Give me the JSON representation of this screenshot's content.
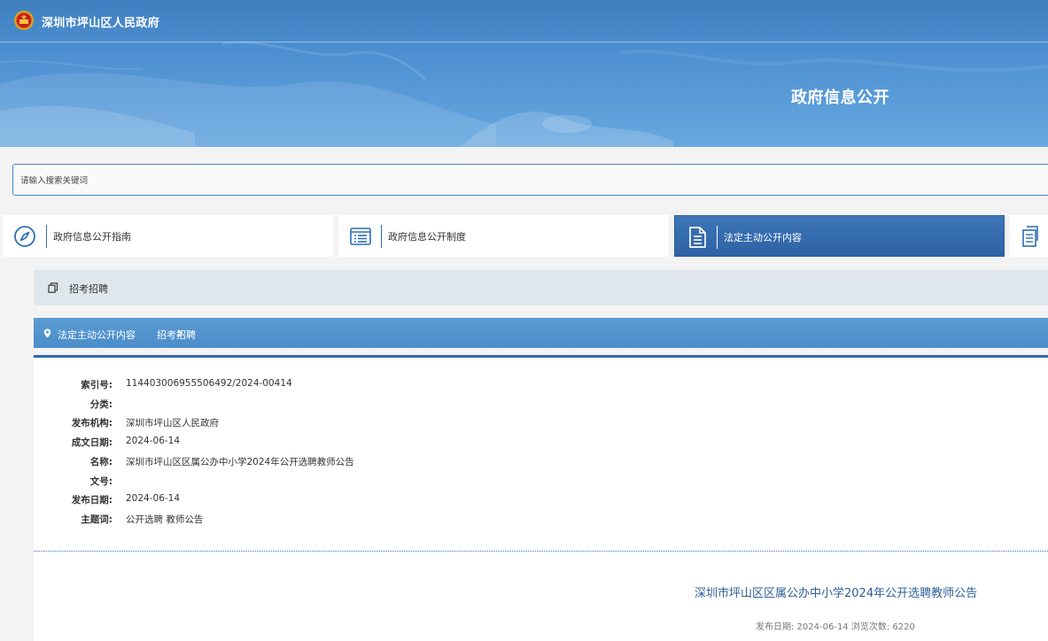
{
  "header": {
    "site_name": "深圳市坪山区人民政府",
    "banner_title": "政府信息公开"
  },
  "search": {
    "placeholder": "请输入搜索关键词",
    "value": ""
  },
  "nav": {
    "tabs": [
      {
        "label": "政府信息公开指南",
        "icon": "compass-icon",
        "active": false
      },
      {
        "label": "政府信息公开制度",
        "icon": "list-document-icon",
        "active": false
      },
      {
        "label": "法定主动公开内容",
        "icon": "document-icon",
        "active": true
      },
      {
        "label": "",
        "icon": "file-stack-icon",
        "active": false
      }
    ]
  },
  "category": {
    "label": "招考招聘",
    "icon": "copy-icon"
  },
  "breadcrumb": {
    "items": [
      "法定主动公开内容",
      "招考招聘"
    ]
  },
  "metadata": [
    {
      "key": "索引号:",
      "value": "11440300695550649​2/2024-00414"
    },
    {
      "key": "分类:",
      "value": ""
    },
    {
      "key": "发布机构:",
      "value": "深圳市坪山区人民政府"
    },
    {
      "key": "成文日期:",
      "value": "2024-06-14"
    },
    {
      "key": "名称:",
      "value": "深圳市坪山区区属公办中小学2024年公开选聘教师公告"
    },
    {
      "key": "文号:",
      "value": ""
    },
    {
      "key": "发布日期:",
      "value": "2024-06-14"
    },
    {
      "key": "主题词:",
      "value": "公开选聘 教师公告"
    }
  ],
  "article": {
    "title": "深圳市坪山区区属公办中小学2024年公开选聘教师公告",
    "meta_line": "发布日期:  2024-06-14   浏览次数:  6220"
  },
  "colors": {
    "accent": "#2f6aaa",
    "banner": "#4d8fd0",
    "title_text": "#2c5f99"
  }
}
